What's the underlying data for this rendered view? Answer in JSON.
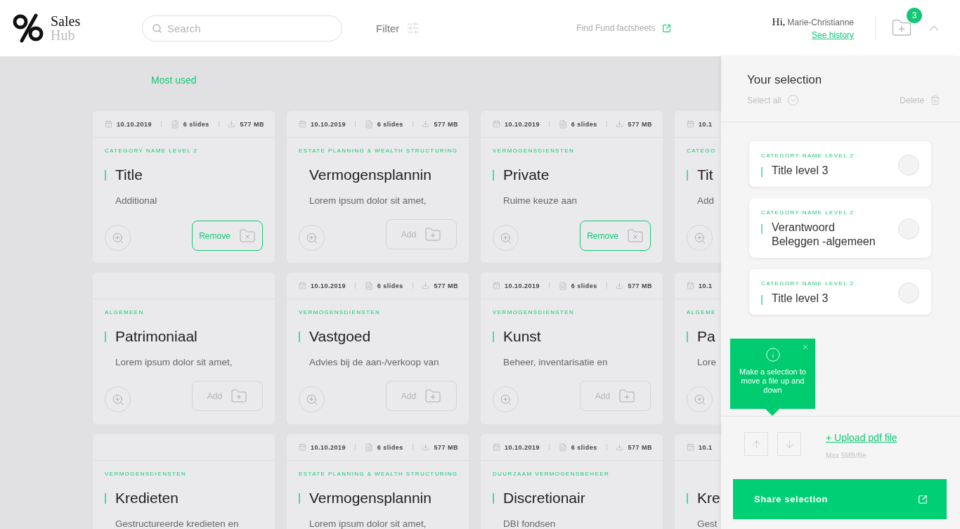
{
  "header": {
    "logo": {
      "top": "Sales",
      "bottom": "Hub"
    },
    "search": {
      "placeholder": "Search"
    },
    "filter": "Filter",
    "factsheets_link": "Find Fund factsheets",
    "greeting": {
      "hi": "Hi,",
      "name": "Marie-Christianne",
      "history_link": "See history"
    },
    "cart_badge": "3"
  },
  "section_title": "Most used",
  "cards": [
    {
      "meta": [
        {
          "kind": "date",
          "text": "10.10.2019"
        },
        {
          "kind": "slides",
          "text": "6 slides"
        },
        {
          "kind": "size",
          "text": "577 MB"
        }
      ],
      "category": "CATEGORY NAME LEVEL 2",
      "marked": true,
      "title": "Title",
      "description": "Additional",
      "zoom": true,
      "action": {
        "kind": "remove",
        "label": "Remove"
      }
    },
    {
      "meta": [
        {
          "kind": "date",
          "text": "10.10.2019"
        },
        {
          "kind": "slides",
          "text": "6 slides"
        },
        {
          "kind": "size",
          "text": "577 MB"
        }
      ],
      "category": "ESTATE PLANNING & WEALTH STRUCTURING",
      "marked": false,
      "title": "Vermogensplannin",
      "description": "Lorem ipsum dolor sit amet,",
      "zoom": true,
      "action": {
        "kind": "add",
        "label": "Add"
      }
    },
    {
      "meta": [
        {
          "kind": "date",
          "text": "10.10.2019"
        },
        {
          "kind": "slides",
          "text": "6 slides"
        },
        {
          "kind": "size",
          "text": "577 MB"
        }
      ],
      "category": "VERMOGENSDIENSTEN",
      "marked": true,
      "title": "Private",
      "description": "Ruime keuze aan",
      "zoom": true,
      "action": {
        "kind": "remove",
        "label": "Remove"
      }
    },
    {
      "meta": [
        {
          "kind": "date",
          "text": "10.1"
        }
      ],
      "category": "CATEGO",
      "marked": true,
      "title": "Tit",
      "description": "Add",
      "zoom": true
    },
    {
      "category": "ALGEMEEN",
      "marked": true,
      "title": "Patrimoniaal",
      "description": "Lorem ipsum dolor sit amet,",
      "zoom": true,
      "action": {
        "kind": "add",
        "label": "Add"
      }
    },
    {
      "meta": [
        {
          "kind": "date",
          "text": "10.10.2019"
        },
        {
          "kind": "slides",
          "text": "6 slides"
        },
        {
          "kind": "size",
          "text": "577 MB"
        }
      ],
      "category": "VERMOGENSDIENSTEN",
      "marked": true,
      "title": "Vastgoed",
      "description": "Advies bij de aan-/verkoop van",
      "zoom": true,
      "action": {
        "kind": "add",
        "label": "Add"
      }
    },
    {
      "meta": [
        {
          "kind": "date",
          "text": "10.10.2019"
        },
        {
          "kind": "slides",
          "text": "6 slides"
        },
        {
          "kind": "size",
          "text": "577 MB"
        }
      ],
      "category": "VERMOGENSDIENSTEN",
      "marked": true,
      "title": "Kunst",
      "description": "Beheer, inventarisatie en",
      "zoom": true,
      "action": {
        "kind": "add",
        "label": "Add"
      }
    },
    {
      "meta": [
        {
          "kind": "date",
          "text": "10.1"
        }
      ],
      "category": "ALGEME",
      "marked": true,
      "title": "Pa",
      "description": "Lore",
      "zoom": true
    },
    {
      "category": "VERMOGENSDIENSTEN",
      "marked": true,
      "title": "Kredieten",
      "description": "Gestructureerde kredieten en"
    },
    {
      "meta": [
        {
          "kind": "date",
          "text": "10.10.2019"
        },
        {
          "kind": "slides",
          "text": "6 slides"
        },
        {
          "kind": "size",
          "text": "577 MB"
        }
      ],
      "category": "ESTATE PLANNING & WEALTH STRUCTURING",
      "marked": true,
      "title": "Vermogensplannin",
      "description": "Lorem ipsum dolor sit amet,"
    },
    {
      "meta": [
        {
          "kind": "date",
          "text": "10.10.2019"
        },
        {
          "kind": "slides",
          "text": "6 slides"
        },
        {
          "kind": "size",
          "text": "577 MB"
        }
      ],
      "category": "DUURZAAM VERMOGENSBEHEER",
      "marked": true,
      "title": "Discretionair",
      "description": "DBI fondsen"
    },
    {
      "meta": [
        {
          "kind": "date",
          "text": "10.1"
        }
      ],
      "marked": true,
      "title": "Kre",
      "description": "Gest"
    }
  ],
  "selection": {
    "title": "Your selection",
    "select_all": "Select all",
    "delete": "Delete",
    "items": [
      {
        "category": "CATEGORY NAME LEVEL 2",
        "title": "Title level 3",
        "selected": false
      },
      {
        "category": "CATEGORY NAME LEVEL 2",
        "title": "Verantwoord Beleggen -algemeen",
        "selected": false
      },
      {
        "category": "CATEGORY NAME LEVEL 2",
        "title": "Title level 3",
        "selected": false
      }
    ],
    "tooltip": "Make a selection to move a file up and down",
    "upload_link": "+ Upload pdf file",
    "upload_hint": "Max 5MB/file",
    "share_button": "Share selection"
  }
}
